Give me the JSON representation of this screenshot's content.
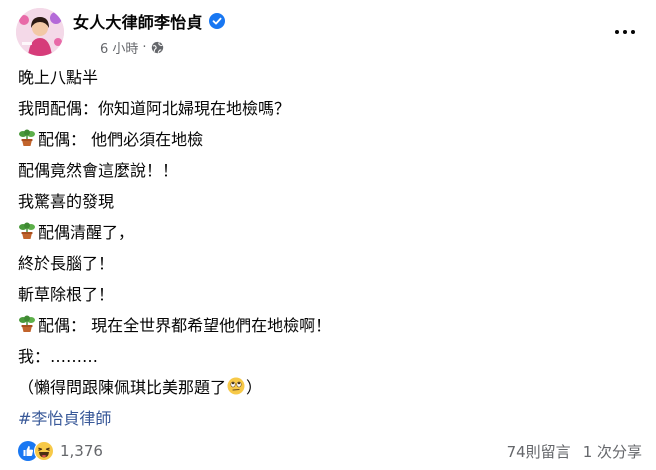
{
  "post": {
    "author": "女人大律師李怡貞",
    "time": "6 小時",
    "separator": "·",
    "lines": [
      "晚上八點半",
      "我問配偶：你知道阿北婦現在地檢嗎？",
      "配偶：  他們必須在地檢",
      "配偶竟然會這麼說！！",
      "我驚喜的發現",
      "配偶清醒了，",
      "終於長腦了！",
      "斬草除根了！",
      "配偶：  現在全世界都希望他們在地檢啊！",
      "我：………",
      "（懶得問跟陳佩琪比美那題了",
      "）"
    ],
    "hashtag": "#李怡貞律師"
  },
  "footer": {
    "reaction_count": "1,376",
    "comments": "74則留言",
    "shares": "1 次分享"
  },
  "icons": {
    "verified": "verified-badge-icon",
    "audience": "globe-icon",
    "plant": "potted-plant-emoji",
    "rolling_eyes": "rolling-eyes-emoji",
    "like": "like-reaction-icon",
    "haha": "haha-reaction-icon"
  },
  "colors": {
    "text": "#050505",
    "secondary": "#65676b",
    "link": "#385898",
    "facebook_blue": "#1877f2"
  }
}
